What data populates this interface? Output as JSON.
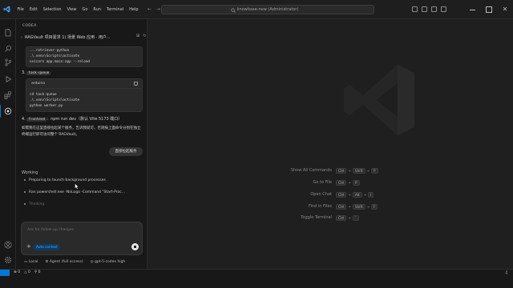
{
  "menu": [
    "File",
    "Edit",
    "Selection",
    "View",
    "Go",
    "Run",
    "Terminal",
    "Help"
  ],
  "command_center": "knowbase-new (Administrator)",
  "panel": {
    "title": "CODEX",
    "thread_title": "RAGVault 项目需求 1) 场景 Web 应用 · 用户..."
  },
  "code1": {
    "lines": [
      "...retriever-python",
      ".\\.venv\\Scripts\\activate",
      "uvicorn app.main:app --reload"
    ]
  },
  "step3": {
    "num": "3.",
    "code": "task-queue"
  },
  "code2": {
    "lang": "arduino",
    "lines": [
      "cd task-queue",
      ".\\.venv\\Scripts\\activate",
      "python worker.py"
    ]
  },
  "step4": {
    "num": "4.",
    "code": "frontend",
    "rest": "：npm run dev（默认 Vite 5173 端口）"
  },
  "para": "如需我在这里直接拉起某个服务，告诉我就可，否则按上面命令分别在独立终端运行即可访问整个 RAGVault。",
  "start_button": "直接拉起服务",
  "working": {
    "label": "Working",
    "items": [
      "Preparing to launch background processes",
      "Ran powershell.exe -NoLogo -Command \"Start-Proc...",
      "Thinking"
    ]
  },
  "composer": {
    "placeholder": "Ask for follow-up changes",
    "auto_context": "Auto context"
  },
  "bottom": {
    "local": "Local",
    "agent": "Agent (full access)",
    "model": "gpt-5-codex high"
  },
  "hints": [
    {
      "label": "Show All Commands",
      "keys": [
        "Ctrl",
        "+",
        "Shift",
        "+",
        "P"
      ]
    },
    {
      "label": "Go to File",
      "keys": [
        "Ctrl",
        "+",
        "P"
      ]
    },
    {
      "label": "Open Chat",
      "keys": [
        "Ctrl",
        "+",
        "Alt",
        "+",
        "I"
      ]
    },
    {
      "label": "Find in Files",
      "keys": [
        "Ctrl",
        "+",
        "Shift",
        "+",
        "F"
      ]
    },
    {
      "label": "Toggle Terminal",
      "keys": [
        "Ctrl",
        "+",
        "`"
      ]
    }
  ],
  "status": {
    "errors": "0",
    "warnings": "0",
    "ports": "0"
  },
  "colors": {
    "accent": "#0078d4",
    "chip": "#4fa8ff"
  }
}
